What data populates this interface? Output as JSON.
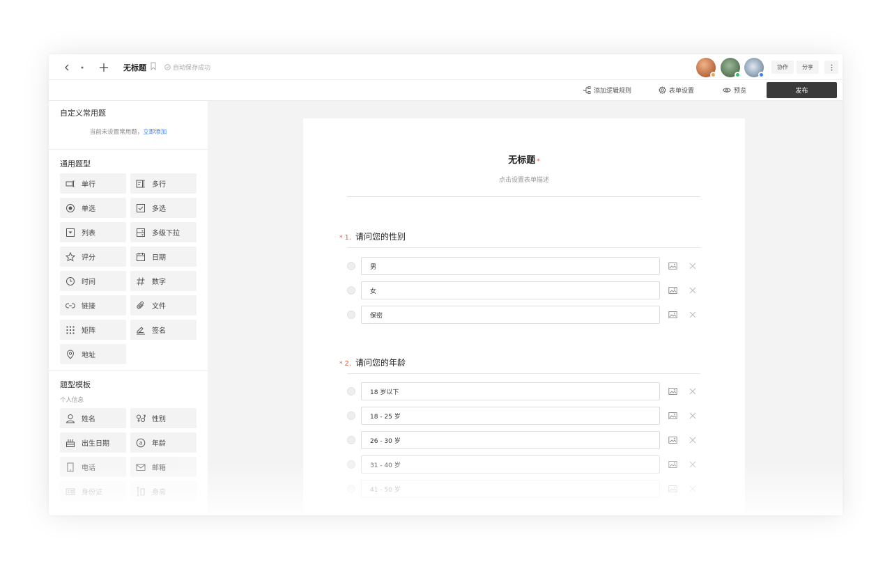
{
  "app": {
    "title": "无标题",
    "save_status": "自动保存成功",
    "collaborate_label": "协作",
    "share_label": "分享"
  },
  "toolbar": {
    "add_logic_label": "添加逻辑规则",
    "form_settings_label": "表单设置",
    "preview_label": "预览",
    "publish_label": "发布"
  },
  "sidebar": {
    "custom": {
      "title": "自定义常用题",
      "hint": "当前未设置常用题，",
      "hint_link": "立即添加"
    },
    "general": {
      "title": "通用题型",
      "items": [
        {
          "label": "单行",
          "icon": "single-line-icon"
        },
        {
          "label": "多行",
          "icon": "multi-line-icon"
        },
        {
          "label": "单选",
          "icon": "radio-icon"
        },
        {
          "label": "多选",
          "icon": "checkbox-icon"
        },
        {
          "label": "列表",
          "icon": "dropdown-icon"
        },
        {
          "label": "多级下拉",
          "icon": "cascade-icon"
        },
        {
          "label": "评分",
          "icon": "star-icon"
        },
        {
          "label": "日期",
          "icon": "calendar-icon"
        },
        {
          "label": "时间",
          "icon": "clock-icon"
        },
        {
          "label": "数字",
          "icon": "hash-icon"
        },
        {
          "label": "链接",
          "icon": "link-icon"
        },
        {
          "label": "文件",
          "icon": "paperclip-icon"
        },
        {
          "label": "矩阵",
          "icon": "grid-icon"
        },
        {
          "label": "签名",
          "icon": "signature-icon"
        },
        {
          "label": "地址",
          "icon": "location-icon"
        }
      ]
    },
    "templates": {
      "title": "题型模板",
      "subtitle": "个人信息",
      "items": [
        {
          "label": "姓名",
          "icon": "person-icon"
        },
        {
          "label": "性别",
          "icon": "gender-icon"
        },
        {
          "label": "出生日期",
          "icon": "birthday-icon"
        },
        {
          "label": "年龄",
          "icon": "at-icon"
        },
        {
          "label": "电话",
          "icon": "phone-icon"
        },
        {
          "label": "邮箱",
          "icon": "mail-icon"
        },
        {
          "label": "身份证",
          "icon": "id-card-icon"
        },
        {
          "label": "身高",
          "icon": "height-icon"
        }
      ]
    }
  },
  "form": {
    "title": "无标题",
    "required_mark": "*",
    "description": "点击设置表单描述",
    "questions": [
      {
        "number": "1.",
        "required_mark": "*",
        "title": "请问您的性别",
        "options": [
          "男",
          "女",
          "保密"
        ]
      },
      {
        "number": "2.",
        "required_mark": "*",
        "title": "请问您的年龄",
        "options": [
          "18 岁以下",
          "18 - 25 岁",
          "26 - 30 岁",
          "31 - 40 岁",
          "41 - 50 岁"
        ]
      }
    ]
  },
  "colors": {
    "accent_required": "#e4573b",
    "link": "#3b82f6",
    "publish_bg": "#3a3a3a"
  }
}
